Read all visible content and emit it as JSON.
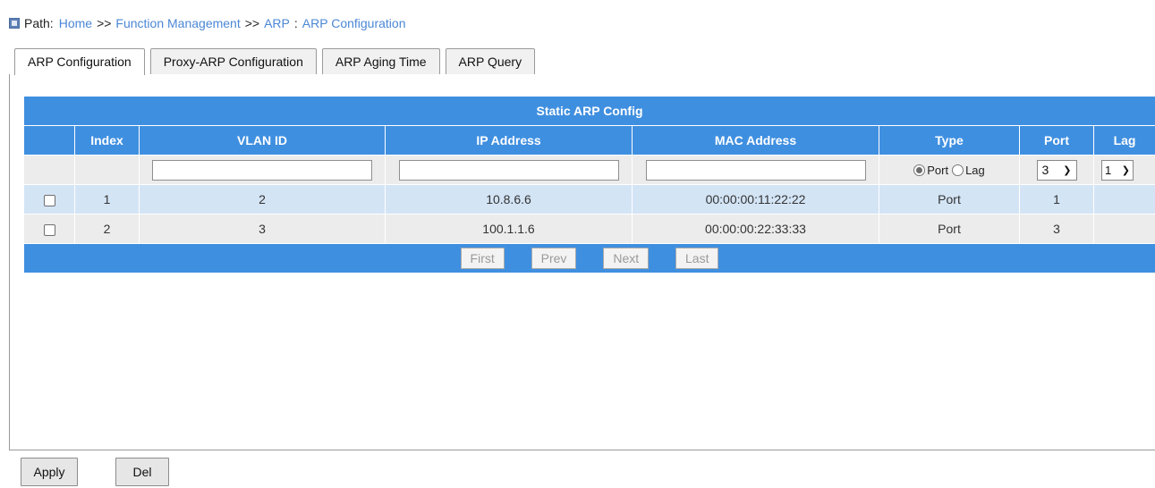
{
  "path": {
    "label": "Path:",
    "crumbs": [
      "Home",
      "Function Management",
      "ARP",
      "ARP Configuration"
    ],
    "separators": [
      ">>",
      ">>",
      ":"
    ]
  },
  "tabs": [
    {
      "label": "ARP Configuration",
      "active": true
    },
    {
      "label": "Proxy-ARP Configuration",
      "active": false
    },
    {
      "label": "ARP Aging Time",
      "active": false
    },
    {
      "label": "ARP Query",
      "active": false
    }
  ],
  "table": {
    "title": "Static ARP Config",
    "headers": [
      "",
      "Index",
      "VLAN ID",
      "IP Address",
      "MAC Address",
      "Type",
      "Port",
      "Lag"
    ],
    "input_row": {
      "vlan_id": "",
      "ip_address": "",
      "mac_address": "",
      "type_options": [
        {
          "label": "Port",
          "selected": true
        },
        {
          "label": "Lag",
          "selected": false
        }
      ],
      "port_value": "3",
      "lag_value": "1"
    },
    "rows": [
      {
        "index": "1",
        "vlan_id": "2",
        "ip": "10.8.6.6",
        "mac": "00:00:00:11:22:22",
        "type": "Port",
        "port": "1",
        "lag": ""
      },
      {
        "index": "2",
        "vlan_id": "3",
        "ip": "100.1.1.6",
        "mac": "00:00:00:22:33:33",
        "type": "Port",
        "port": "3",
        "lag": ""
      }
    ]
  },
  "pager": {
    "first": "First",
    "prev": "Prev",
    "next": "Next",
    "last": "Last"
  },
  "actions": {
    "apply": "Apply",
    "del": "Del"
  },
  "colors": {
    "header_blue": "#3f8fe0",
    "row_blue": "#d3e4f5",
    "row_gray": "#ececec",
    "link": "#4b87d6"
  }
}
